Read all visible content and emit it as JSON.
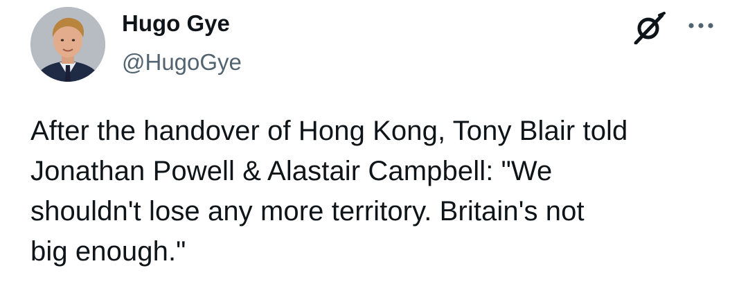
{
  "author": {
    "display_name": "Hugo Gye",
    "handle": "@HugoGye"
  },
  "icons": {
    "avatar": "profile-photo",
    "grok": "grok-icon",
    "more": "more-options-icon"
  },
  "tweet": {
    "text": "After the handover of Hong Kong, Tony Blair told\nJonathan Powell & Alastair Campbell: \"We\nshouldn't lose any more territory. Britain's not\nbig enough.\""
  },
  "colors": {
    "text_primary": "#0f1419",
    "text_secondary": "#536471",
    "background": "#ffffff"
  }
}
